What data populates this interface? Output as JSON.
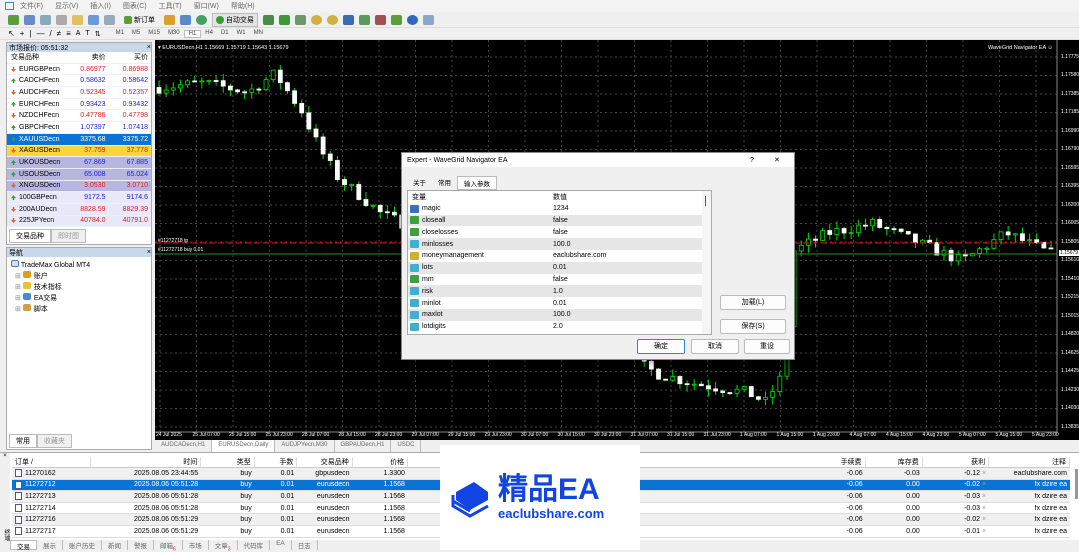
{
  "menu": [
    "文件(F)",
    "显示(V)",
    "插入(I)",
    "图表(C)",
    "工具(T)",
    "窗口(W)",
    "帮助(H)"
  ],
  "toolbar": {
    "new_order": "新订单",
    "auto_trading": "自动交易",
    "timeframes": [
      "M1",
      "M5",
      "M15",
      "M30",
      "H1",
      "H4",
      "D1",
      "W1",
      "MN"
    ],
    "active_tf": "H1"
  },
  "market_watch": {
    "title": "市场报价: 05:51:32",
    "headers": [
      "交易品种",
      "卖价",
      "买价"
    ],
    "rows": [
      {
        "symbol": "EURGBPecn",
        "bid": "0.86977",
        "ask": "0.86988",
        "dir": "down",
        "color": "#e02020",
        "bg": "#ffffff"
      },
      {
        "symbol": "CADCHFecn",
        "bid": "0.58632",
        "ask": "0.58642",
        "dir": "up",
        "color": "#2020e0",
        "bg": "#ffffff"
      },
      {
        "symbol": "AUDCHFecn",
        "bid": "0.52345",
        "ask": "0.52357",
        "dir": "down",
        "color": "#e02020",
        "bg": "#ffffff"
      },
      {
        "symbol": "EURCHFecn",
        "bid": "0.93423",
        "ask": "0.93432",
        "dir": "up",
        "color": "#2020e0",
        "bg": "#ffffff"
      },
      {
        "symbol": "NZDCHFecn",
        "bid": "0.47786",
        "ask": "0.47798",
        "dir": "down",
        "color": "#e02020",
        "bg": "#ffffff"
      },
      {
        "symbol": "GBPCHFecn",
        "bid": "1.07397",
        "ask": "1.07418",
        "dir": "up",
        "color": "#2020e0",
        "bg": "#ffffff"
      },
      {
        "symbol": "XAUUSDecn",
        "bid": "3375.68",
        "ask": "3375.72",
        "dir": "up",
        "color": "#ffffff",
        "bg": "#0a74d6"
      },
      {
        "symbol": "XAGUSDecn",
        "bid": "37.759",
        "ask": "37.778",
        "dir": "down",
        "color": "#e02020",
        "bg": "#ffd33a"
      },
      {
        "symbol": "UKOUSDecn",
        "bid": "67.869",
        "ask": "67.885",
        "dir": "up",
        "color": "#2020e0",
        "bg": "#b6b6e0"
      },
      {
        "symbol": "USOUSDecn",
        "bid": "65.008",
        "ask": "65.024",
        "dir": "up",
        "color": "#2020e0",
        "bg": "#b6b6e0"
      },
      {
        "symbol": "XNGUSDecn",
        "bid": "3.0530",
        "ask": "3.0710",
        "dir": "down",
        "color": "#e02020",
        "bg": "#b6b6e0"
      },
      {
        "symbol": "100GBPecn",
        "bid": "9172.5",
        "ask": "9174.6",
        "dir": "up",
        "color": "#2020e0",
        "bg": "#e8e8f8"
      },
      {
        "symbol": "200AUDecn",
        "bid": "8828.59",
        "ask": "8829.39",
        "dir": "down",
        "color": "#e02020",
        "bg": "#e8e8f8"
      },
      {
        "symbol": "225JPYecn",
        "bid": "40784.0",
        "ask": "40791.0",
        "dir": "down",
        "color": "#e02020",
        "bg": "#e8e8f8"
      }
    ],
    "tabs": [
      "交易品种",
      "即时图"
    ]
  },
  "navigator": {
    "title": "导航",
    "root": "TradeMax Global MT4",
    "items": [
      "账户",
      "技术指标",
      "EA交易",
      "脚本"
    ],
    "tabs": [
      "常用",
      "收藏夹"
    ]
  },
  "chart": {
    "header": "EURUSDecn,H1  1.15669 1.15719 1.15643 1.15679",
    "ea_label": "WaveGrid Navigator EA",
    "order_line_1": "#11272718 tp",
    "order_line_2": "#11272718 buy 0.01",
    "current_price": "1.15679",
    "price_labels": [
      "1.17775",
      "1.17580",
      "1.17385",
      "1.17185",
      "1.16990",
      "1.16790",
      "1.16595",
      "1.16395",
      "1.16200",
      "1.16005",
      "1.15805",
      "1.15610",
      "1.15410",
      "1.15215",
      "1.15015",
      "1.14820",
      "1.14625",
      "1.14425",
      "1.14230",
      "1.14030",
      "1.13835"
    ],
    "time_labels": [
      "24 Jul 2025",
      "25 Jul 07:00",
      "25 Jul 15:00",
      "25 Jul 23:00",
      "28 Jul 07:00",
      "28 Jul 15:00",
      "28 Jul 23:00",
      "29 Jul 07:00",
      "29 Jul 15:00",
      "29 Jul 23:00",
      "30 Jul 07:00",
      "30 Jul 15:00",
      "30 Jul 23:00",
      "31 Jul 07:00",
      "31 Jul 15:00",
      "31 Jul 23:00",
      "1 Aug 07:00",
      "1 Aug 15:00",
      "1 Aug 23:00",
      "4 Aug 07:00",
      "4 Aug 15:00",
      "4 Aug 23:00",
      "5 Aug 07:00",
      "5 Aug 15:00",
      "5 Aug 23:00"
    ],
    "tabs": [
      "AUDCADecn,H1",
      "EURUSDecn,Daily",
      "AUDJPYecn,M30",
      "GBPAUDecn,H1",
      "USDC"
    ]
  },
  "chart_data": {
    "type": "candlestick",
    "symbol": "EURUSDecn",
    "timeframe": "H1",
    "ylim": [
      1.13835,
      1.17775
    ],
    "price_path": [
      [
        0,
        1.1745
      ],
      [
        0.05,
        1.175
      ],
      [
        0.1,
        1.174
      ],
      [
        0.13,
        1.176
      ],
      [
        0.16,
        1.172
      ],
      [
        0.18,
        1.168
      ],
      [
        0.2,
        1.165
      ],
      [
        0.25,
        1.161
      ],
      [
        0.3,
        1.159
      ],
      [
        0.4,
        1.1585
      ],
      [
        0.45,
        1.16
      ],
      [
        0.5,
        1.159
      ],
      [
        0.52,
        1.157
      ],
      [
        0.54,
        1.145
      ],
      [
        0.56,
        1.144
      ],
      [
        0.6,
        1.143
      ],
      [
        0.66,
        1.142
      ],
      [
        0.68,
        1.141
      ],
      [
        0.7,
        1.144
      ],
      [
        0.71,
        1.157
      ],
      [
        0.75,
        1.159
      ],
      [
        0.8,
        1.16
      ],
      [
        0.85,
        1.158
      ],
      [
        0.9,
        1.156
      ],
      [
        0.95,
        1.159
      ],
      [
        1,
        1.1568
      ]
    ]
  },
  "dialog": {
    "title": "Expert - WaveGrid Navigator EA",
    "help": "?",
    "close": "✕",
    "tabs": [
      "关于",
      "常用",
      "输入参数"
    ],
    "active_tab": "输入参数",
    "headers": [
      "变量",
      "数值"
    ],
    "params": [
      {
        "name": "magic",
        "value": "1234",
        "type": "int"
      },
      {
        "name": "closeall",
        "value": "false",
        "type": "bool"
      },
      {
        "name": "closelosses",
        "value": "false",
        "type": "bool"
      },
      {
        "name": "minlosses",
        "value": "100.0",
        "type": "double"
      },
      {
        "name": "moneymanagement",
        "value": "eaclubshare.com",
        "type": "string"
      },
      {
        "name": "lots",
        "value": "0.01",
        "type": "double"
      },
      {
        "name": "mm",
        "value": "false",
        "type": "bool"
      },
      {
        "name": "risk",
        "value": "1.0",
        "type": "double"
      },
      {
        "name": "minlot",
        "value": "0.01",
        "type": "double"
      },
      {
        "name": "maxlot",
        "value": "100.0",
        "type": "double"
      },
      {
        "name": "lotdigits",
        "value": "2.0",
        "type": "double"
      }
    ],
    "load": "加载(L)",
    "save": "保存(S)",
    "ok": "确定",
    "cancel": "取消",
    "reset": "重设"
  },
  "terminal": {
    "headers": [
      "订单 /",
      "时间",
      "类型",
      "手数",
      "交易品种",
      "价格",
      "手续费",
      "库存费",
      "获利",
      "注释"
    ],
    "rows": [
      [
        "11270162",
        "2025.08.05 23:44:55",
        "buy",
        "0.01",
        "gbpusdecn",
        "1.3300",
        "-0.06",
        "-0.03",
        "-0.12",
        "eaclubshare.com"
      ],
      [
        "11272712",
        "2025.08.06 05:51:28",
        "buy",
        "0.01",
        "eurusdecn",
        "1.1568",
        "-0.06",
        "0.00",
        "-0.02",
        "fx dzire ea"
      ],
      [
        "11272713",
        "2025.08.06 05:51:28",
        "buy",
        "0.01",
        "eurusdecn",
        "1.1568",
        "-0.06",
        "0.00",
        "-0.03",
        "fx dzire ea"
      ],
      [
        "11272714",
        "2025.08.06 05:51:28",
        "buy",
        "0.01",
        "eurusdecn",
        "1.1568",
        "-0.06",
        "0.00",
        "-0.03",
        "fx dzire ea"
      ],
      [
        "11272716",
        "2025.08.06 05:51:29",
        "buy",
        "0.01",
        "eurusdecn",
        "1.1568",
        "-0.06",
        "0.00",
        "-0.02",
        "fx dzire ea"
      ],
      [
        "11272717",
        "2025.08.06 05:51:29",
        "buy",
        "0.01",
        "eurusdecn",
        "1.1568",
        "-0.06",
        "0.00",
        "-0.01",
        "fx dzire ea"
      ]
    ],
    "selected": 1,
    "tabs": [
      {
        "label": "交易"
      },
      {
        "label": "展示"
      },
      {
        "label": "账户历史"
      },
      {
        "label": "新闻"
      },
      {
        "label": "警报"
      },
      {
        "label": "邮箱",
        "badge": "6"
      },
      {
        "label": "市场"
      },
      {
        "label": "文章",
        "badge": "3"
      },
      {
        "label": "代码库"
      },
      {
        "label": "EA"
      },
      {
        "label": "日志"
      }
    ],
    "side_label": "终端"
  },
  "watermark": {
    "title": "精品EA",
    "url": "eaclubshare.com"
  }
}
